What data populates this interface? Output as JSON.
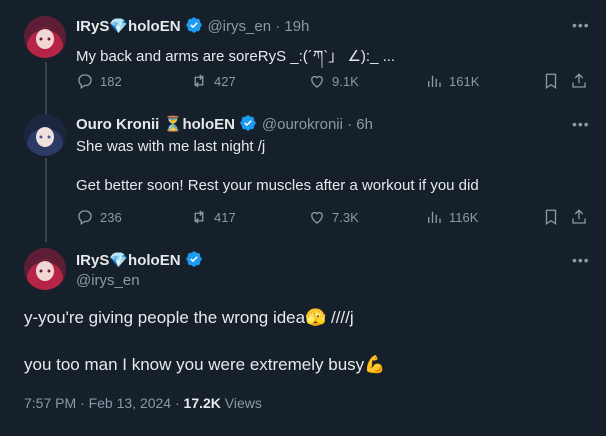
{
  "tweets": [
    {
      "name": "IRyS",
      "name_emoji": "💎",
      "name_suffix": "holoEN",
      "handle_time": "@irys_en · 19h",
      "text": "My back and arms are soreRyS _:(´ཀ`」 ∠):_ ...",
      "replies": "182",
      "retweets": "427",
      "likes": "9.1K",
      "views": "161K"
    },
    {
      "name": "Ouro Kronii",
      "name_emoji": "⏳",
      "name_suffix": "holoEN",
      "handle_time": "@ourokronii · 6h",
      "text_line1": "She was with me last night /j",
      "text_line2": "Get better soon! Rest your muscles after a workout if you did",
      "replies": "236",
      "retweets": "417",
      "likes": "7.3K",
      "views": "116K"
    }
  ],
  "main": {
    "name": "IRyS",
    "name_emoji": "💎",
    "name_suffix": "holoEN",
    "handle": "@irys_en",
    "line1": "y-you're giving people the wrong idea",
    "line1_emoji": "🫣",
    "line1_end": " ////j",
    "line2": "you too man I know you were extremely busy",
    "line2_emoji": "💪",
    "timestamp": "7:57 PM · Feb 13, 2024 · ",
    "views_count": "17.2K",
    "views_label": " Views"
  },
  "colors": {
    "background": "#15202b",
    "text": "#e7e9ea",
    "secondary": "#8b98a5",
    "verified": "#1d9bf0",
    "line": "#38444d"
  }
}
